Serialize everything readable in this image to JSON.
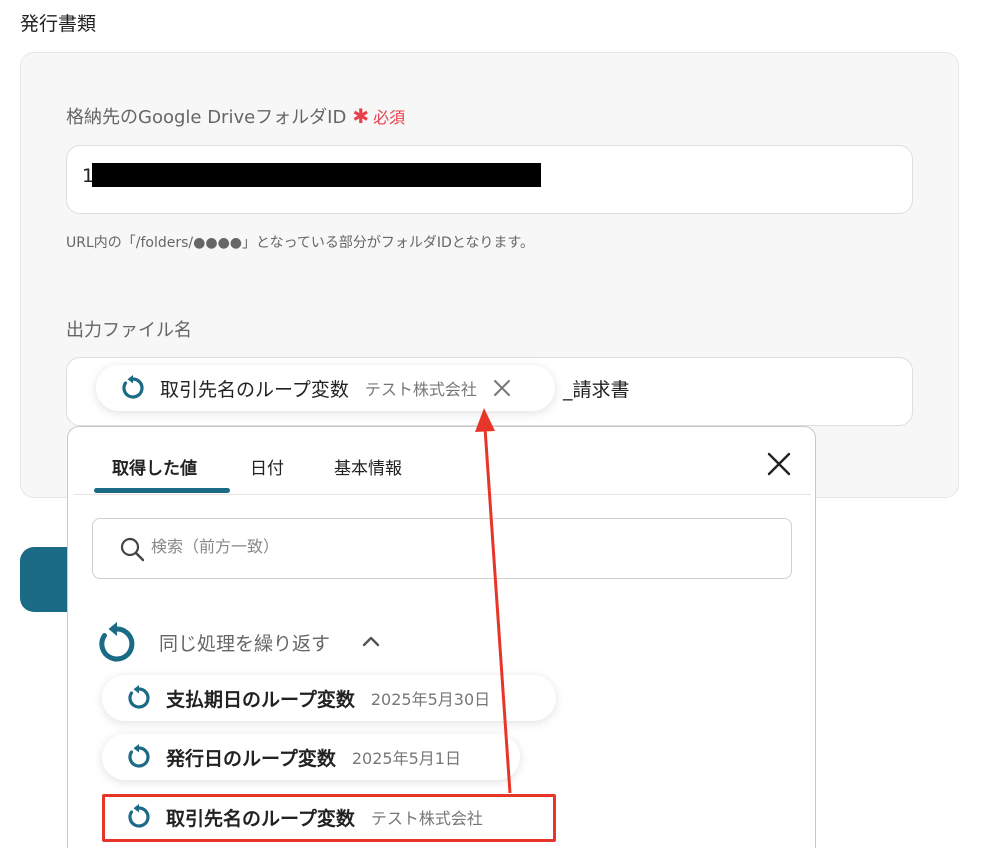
{
  "section_title": "発行書類",
  "colors": {
    "accent": "#1b6a86",
    "required": "#e8404a",
    "annotation": "#e8352a"
  },
  "folder_field": {
    "label": "格納先のGoogle DriveフォルダID",
    "required_star": "✱",
    "required_label": "必須",
    "value": "1",
    "helper": "URL内の「/folders/●●●●」となっている部分がフォルダIDとなります。"
  },
  "filename_field": {
    "label": "出力ファイル名",
    "chip": {
      "icon": "loop-icon",
      "label": "取引先名のループ変数",
      "sub": "テスト株式会社",
      "close_icon": "close-icon"
    },
    "suffix": "_請求書"
  },
  "dropdown": {
    "tabs": [
      {
        "label": "取得した値",
        "active": true
      },
      {
        "label": "日付",
        "active": false
      },
      {
        "label": "基本情報",
        "active": false
      }
    ],
    "close_icon": "close-icon",
    "search": {
      "placeholder": "検索（前方一致）",
      "icon": "search-icon"
    },
    "group": {
      "icon": "loop-icon",
      "label": "同じ処理を繰り返す",
      "chevron": "chevron-up-icon",
      "items": [
        {
          "label": "支払期日のループ変数",
          "sub": "2025年5月30日"
        },
        {
          "label": "発行日のループ変数",
          "sub": "2025年5月1日"
        },
        {
          "label": "取引先名のループ変数",
          "sub": "テスト株式会社"
        }
      ]
    }
  }
}
